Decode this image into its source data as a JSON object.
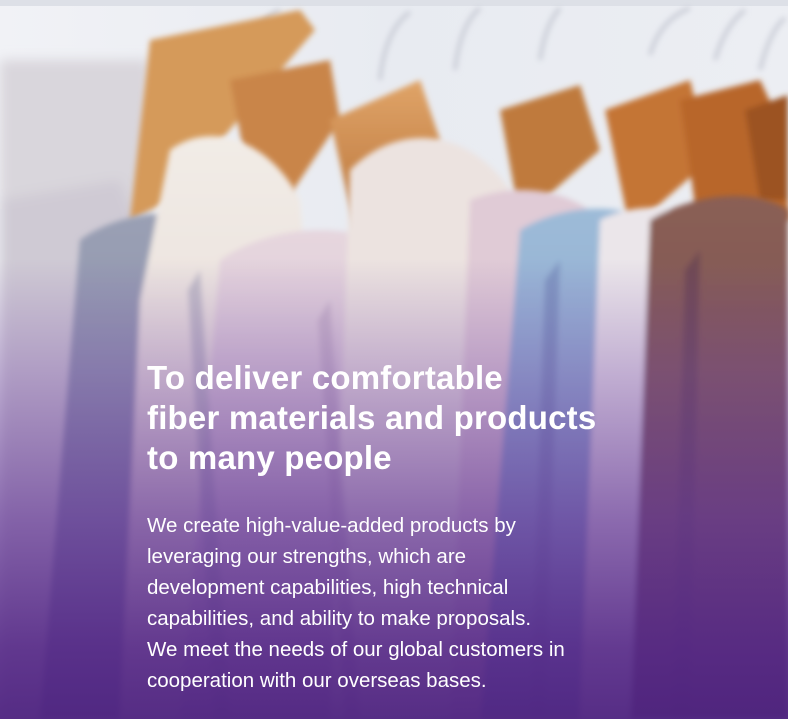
{
  "hero": {
    "headline_lines": [
      "To deliver comfortable",
      "fiber materials and products",
      "to many people"
    ],
    "body_lines": [
      "We create high-value-added products by",
      "leveraging our strengths, which are",
      "development capabilities, high technical",
      "capabilities, and ability to make proposals.",
      "We meet the needs of our global customers in",
      "cooperation with our overseas bases."
    ],
    "colors": {
      "overlay_purple": "#4e2380",
      "text": "#ffffff",
      "hanger_wood": "#c98a4e",
      "wall": "#eef0f4"
    },
    "image_subject": "clothing-on-hangers-photo"
  }
}
